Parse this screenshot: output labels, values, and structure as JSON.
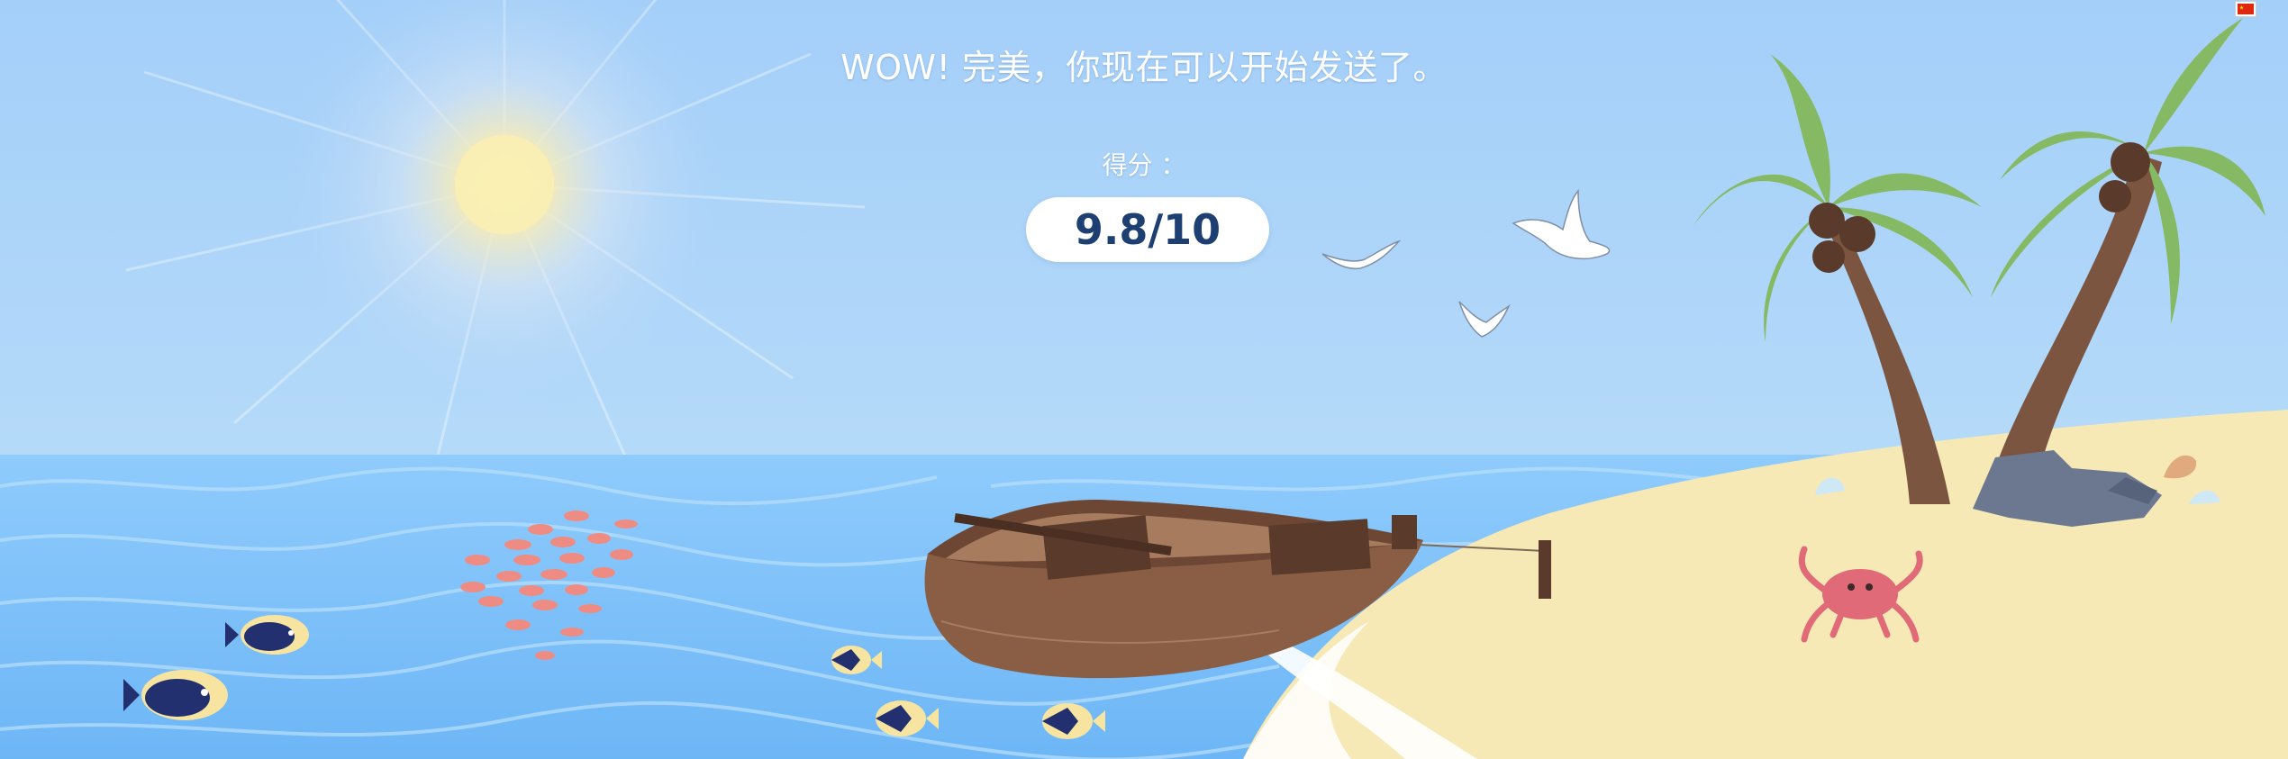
{
  "message": "WOW! 完美，你现在可以开始发送了。",
  "score": {
    "label": "得分 ：",
    "value": "9.8/10"
  },
  "language_flag": "china-flag-icon",
  "colors": {
    "sky": "#a9d2fb",
    "sea": "#7ec1fb",
    "sand": "#f6e9b6",
    "score_text": "#1d3f72",
    "boat": "#8a5e44",
    "palm_trunk": "#7b5540",
    "palm_leaf": "#86b964",
    "crab": "#e06a78"
  }
}
